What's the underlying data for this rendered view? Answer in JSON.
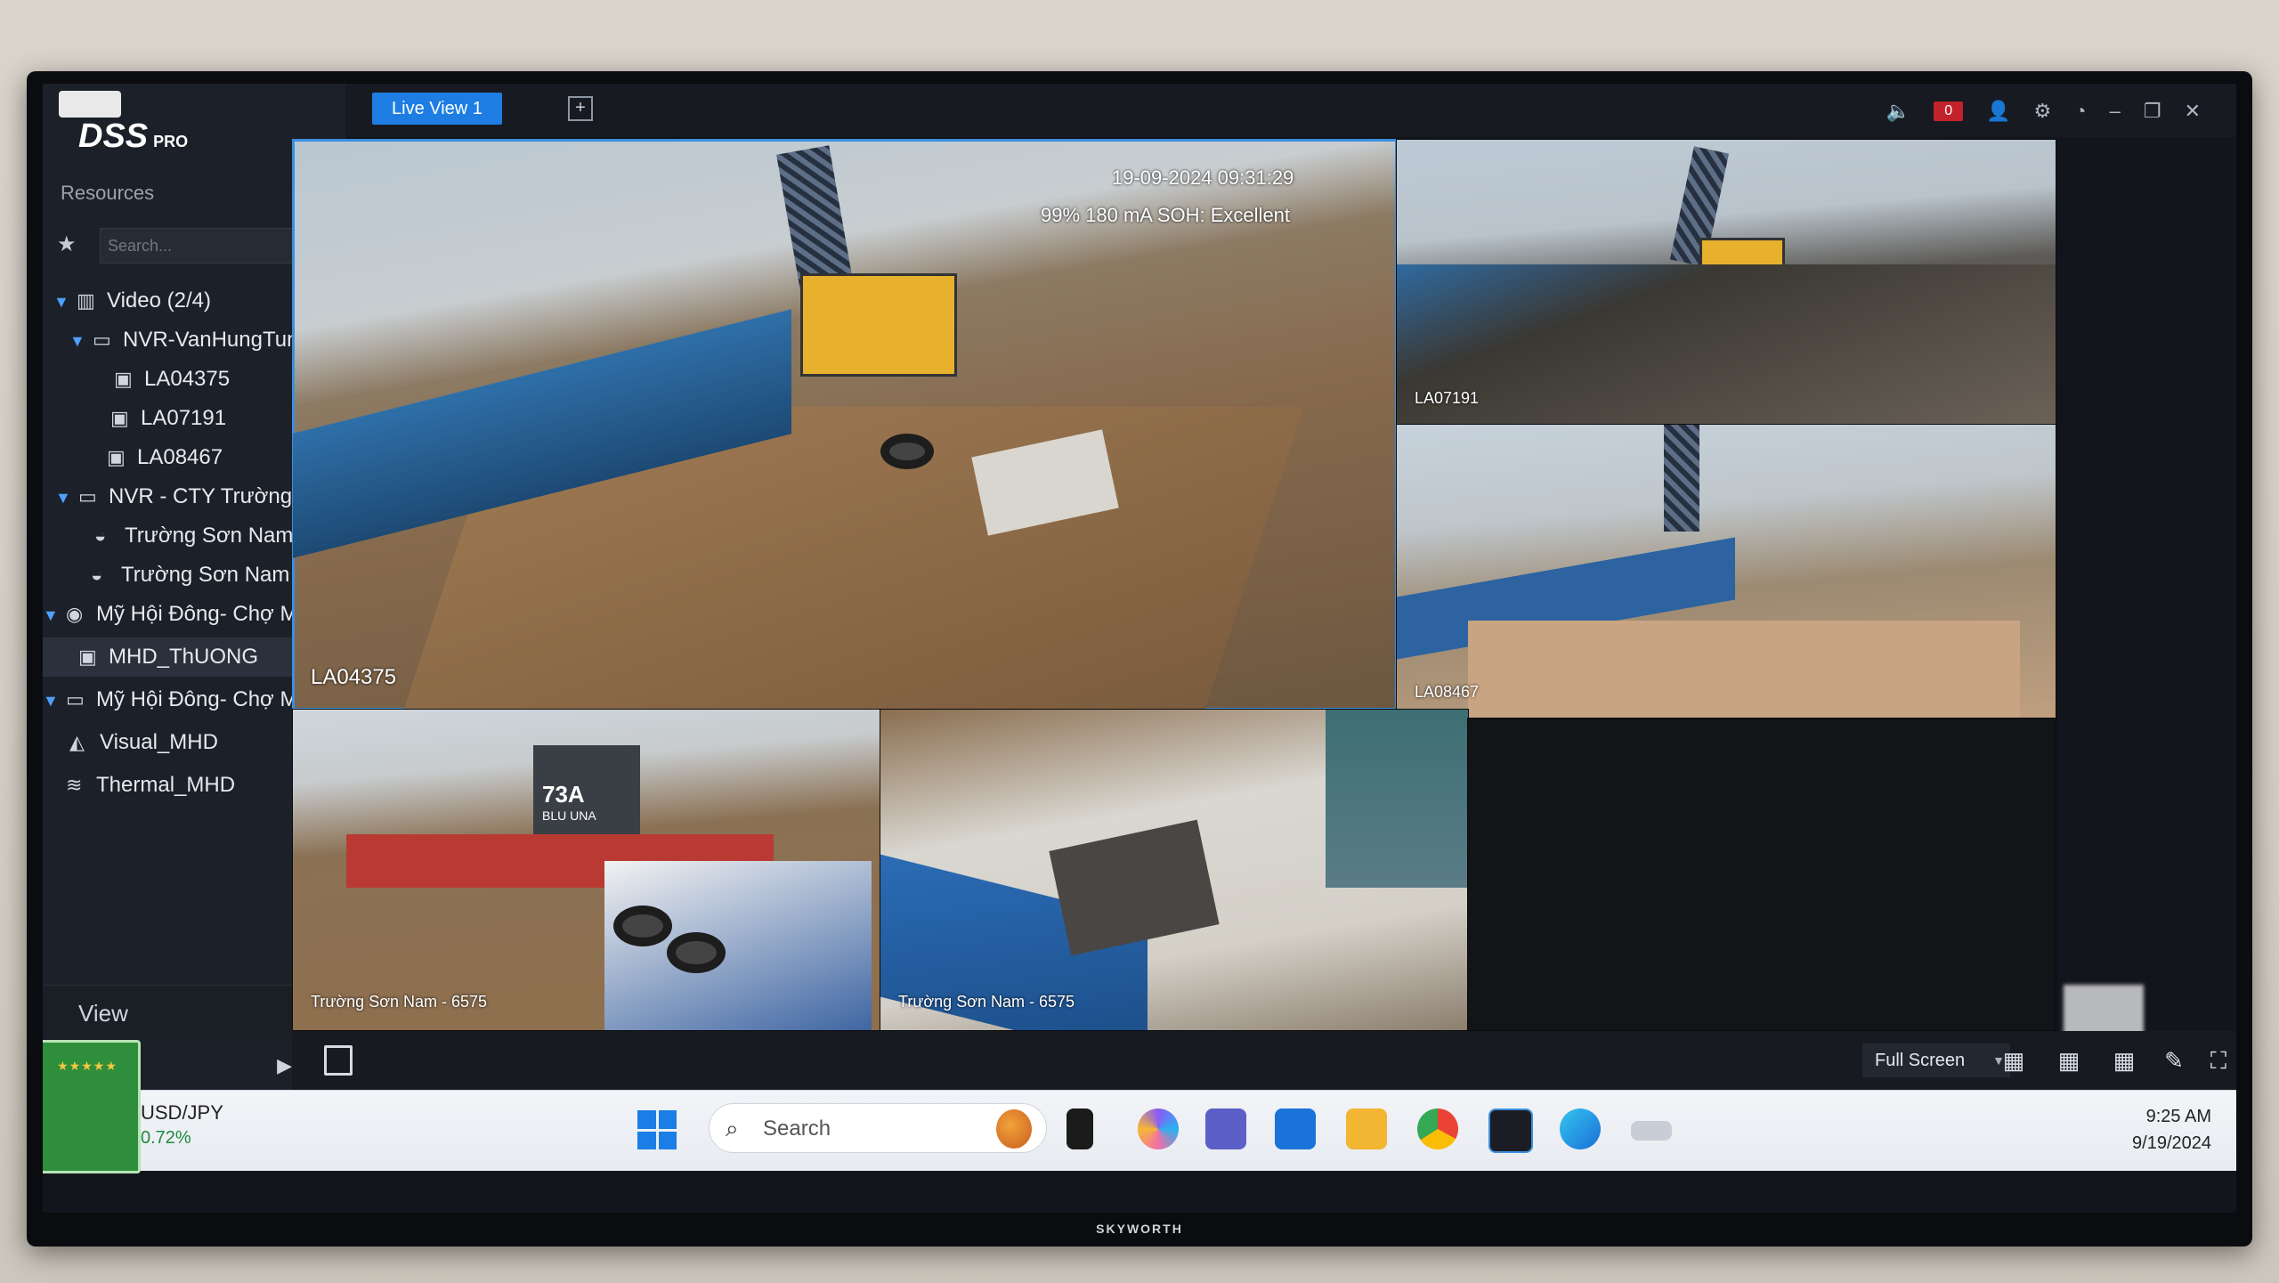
{
  "app": {
    "name": "DSS",
    "edition": "PRO"
  },
  "tv_brand": "SKYWORTH",
  "sidebar": {
    "resources_label": "Resources",
    "search_placeholder": "Search...",
    "tree": [
      {
        "label": "Video (2/4)",
        "level": 0,
        "icon": "video-tree-icon"
      },
      {
        "label": "NVR-VanHungTung",
        "level": 1,
        "icon": "nvr-icon"
      },
      {
        "label": "LA04375",
        "level": 2,
        "icon": "camera-icon"
      },
      {
        "label": "LA07191",
        "level": 2,
        "icon": "camera-icon"
      },
      {
        "label": "LA08467",
        "level": 2,
        "icon": "camera-icon"
      },
      {
        "label": "NVR - CTY Trường Sơr",
        "level": 1,
        "icon": "nvr-icon"
      },
      {
        "label": "Trường Sơn Nam -",
        "level": 2,
        "icon": "dome-camera-icon"
      },
      {
        "label": "Trường Sơn Nam -",
        "level": 2,
        "icon": "dome-camera-icon"
      },
      {
        "label": "Mỹ Hội Đông- Chợ M",
        "level": 1,
        "icon": "device-icon"
      },
      {
        "label": "MHD_ThUONG",
        "level": 2,
        "icon": "camera-icon",
        "selected": true
      },
      {
        "label": "Mỹ Hội Đông- Chợ M",
        "level": 1,
        "icon": "nvr-icon"
      },
      {
        "label": "Visual_MHD",
        "level": 2,
        "icon": "visual-camera-icon"
      },
      {
        "label": "Thermal_MHD",
        "level": 2,
        "icon": "thermal-camera-icon"
      }
    ],
    "view_label": "View"
  },
  "topbar": {
    "tab_label": "Live View 1",
    "alarm_count": "0"
  },
  "videos": {
    "main": {
      "timestamp": "19-09-2024 09:31:29",
      "battery": "99% 180 mA SOH: Excellent",
      "label": "LA04375"
    },
    "top_right": {
      "label": "LA07191"
    },
    "mid_right": {
      "label": "LA08467"
    },
    "bottom_left": {
      "label": "Trường Sơn Nam - 6575",
      "boat_text": "73A",
      "boat_name": "BLU UNA"
    },
    "bottom_mid": {
      "label": "Trường Sơn Nam - 6575"
    }
  },
  "bottombar": {
    "fullscreen_label": "Full Screen"
  },
  "taskbar": {
    "widget_symbol": "USD/JPY",
    "widget_change": "0.72%",
    "search_placeholder": "Search",
    "time": "9:25 AM",
    "date": "9/19/2024"
  },
  "colors": {
    "accent": "#1e7de3",
    "active_border": "#3b8fe0",
    "alarm": "#c2232a"
  }
}
